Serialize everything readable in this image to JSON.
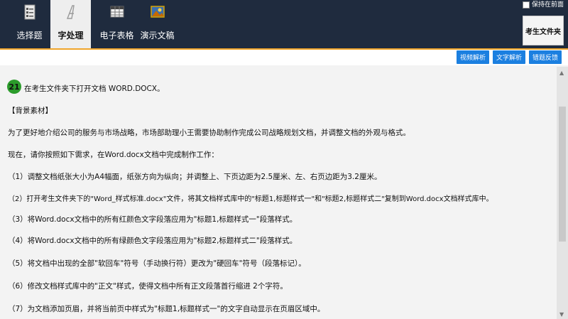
{
  "tabs": [
    {
      "label": "选择题",
      "icon": "document-list-icon",
      "active": false
    },
    {
      "label": "字处理",
      "icon": "letter-a-icon",
      "active": true
    },
    {
      "label": "电子表格",
      "icon": "spreadsheet-icon",
      "active": false
    },
    {
      "label": "演示文稿",
      "icon": "picture-icon",
      "active": false
    }
  ],
  "keep_on_top": {
    "label": "保持在前面",
    "checked": false
  },
  "folder_button": "考生文件夹",
  "action_buttons": [
    "视频解析",
    "文字解析",
    "错题反馈"
  ],
  "colors": {
    "header": "#1f2b3e",
    "accent": "#f0a52a",
    "button": "#1b7fe0",
    "badge": "#2b9b2b"
  },
  "question": {
    "number": "21",
    "title": "在考生文件夹下打开文档 WORD.DOCX。",
    "section": "【背景素材】",
    "intro": "为了更好地介绍公司的服务与市场战略，市场部助理小王需要协助制作完成公司战略规划文档，并调整文档的外观与格式。",
    "instruction": "现在，请你按照如下需求，在Word.docx文档中完成制作工作：",
    "items": [
      "（1）调整文档纸张大小为A4幅面，纸张方向为纵向；并调整上、下页边距为2.5厘米、左、右页边距为3.2厘米。",
      "（2）打开考生文件夹下的\"Word_样式标准.docx\"文件，将其文档样式库中的\"标题1,标题样式一\"和\"标题2,标题样式二\"复制到Word.docx文档样式库中。",
      "（3）将Word.docx文档中的所有红颜色文字段落应用为\"标题1,标题样式一\"段落样式。",
      "（4）将Word.docx文档中的所有绿颜色文字段落应用为\"标题2,标题样式二\"段落样式。",
      "（5）将文档中出现的全部\"软回车\"符号（手动换行符）更改为\"硬回车\"符号（段落标记）。",
      "（6）修改文档样式库中的\"正文\"样式，使得文档中所有正文段落首行缩进 2个字符。",
      "（7）为文档添加页眉，并将当前页中样式为\"标题1,标题样式一\"的文字自动显示在页眉区域中。"
    ]
  }
}
